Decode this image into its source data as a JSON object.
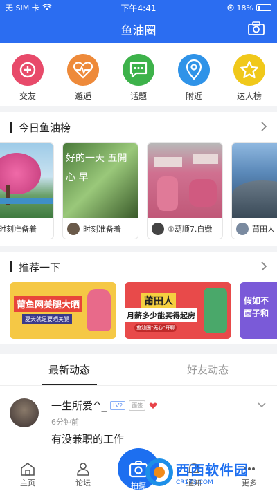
{
  "status": {
    "carrier": "无 SIM 卡",
    "time": "下午4:41",
    "battery": "18%"
  },
  "header": {
    "title": "鱼油圈"
  },
  "features": [
    {
      "label": "交友",
      "icon": "plus-circle-icon",
      "color": "#e84a6a"
    },
    {
      "label": "邂逅",
      "icon": "heart-pulse-icon",
      "color": "#ee8a3a"
    },
    {
      "label": "话题",
      "icon": "chat-bubble-icon",
      "color": "#3db24a"
    },
    {
      "label": "附近",
      "icon": "location-pin-icon",
      "color": "#2f93e8"
    },
    {
      "label": "达人榜",
      "icon": "star-icon",
      "color": "#f0c81a"
    }
  ],
  "today": {
    "title": "今日鱼油榜",
    "cards": [
      {
        "user": "时刻准备着"
      },
      {
        "user": "时刻准备着",
        "img_text": "好的一天 五開心 早"
      },
      {
        "user": "①葫顺7.自嫐"
      },
      {
        "user": "莆田人"
      }
    ]
  },
  "recommend": {
    "title": "推荐一下",
    "banners": [
      {
        "line1": "莆鱼网美腿大晒",
        "line2": "夏天就是要晒美腿"
      },
      {
        "line1": "莆田人",
        "line2": "月薪多少能买得起房",
        "tag": "鱼油圈\"无心\"开聊"
      },
      {
        "line1": "假如不",
        "line2": "面子和"
      }
    ]
  },
  "feed_tabs": [
    {
      "label": "最新动态",
      "active": true
    },
    {
      "label": "好友动态",
      "active": false
    }
  ],
  "post": {
    "username": "一生所爱^_",
    "level": "LV2",
    "badge2": "面签",
    "time": "6分钟前",
    "content": "有没兼职的工作"
  },
  "tabbar": {
    "items": [
      {
        "label": "主页",
        "icon": "home-icon"
      },
      {
        "label": "论坛",
        "icon": "forum-icon"
      },
      {
        "label": "拍摄",
        "icon": "camera-icon"
      },
      {
        "label": "通知",
        "icon": "bell-icon"
      },
      {
        "label": "更多",
        "icon": "more-icon"
      }
    ]
  },
  "watermark": {
    "brand": "西西软件园",
    "url": "CR173.COM"
  }
}
